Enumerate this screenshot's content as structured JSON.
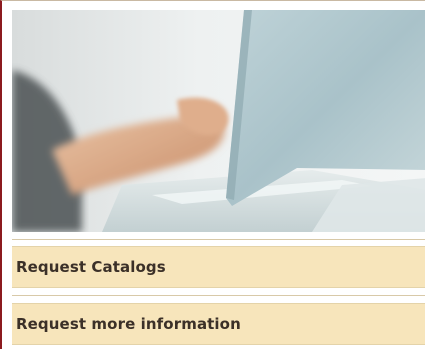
{
  "hero": {
    "image_description_icon": "laptop-typing-photo"
  },
  "links": {
    "request_catalogs": "Request Catalogs",
    "request_more_information": "Request more information"
  },
  "colors": {
    "accent_border": "#8c1a1f",
    "link_background": "#f7e5bb",
    "link_text": "#3b3028"
  }
}
